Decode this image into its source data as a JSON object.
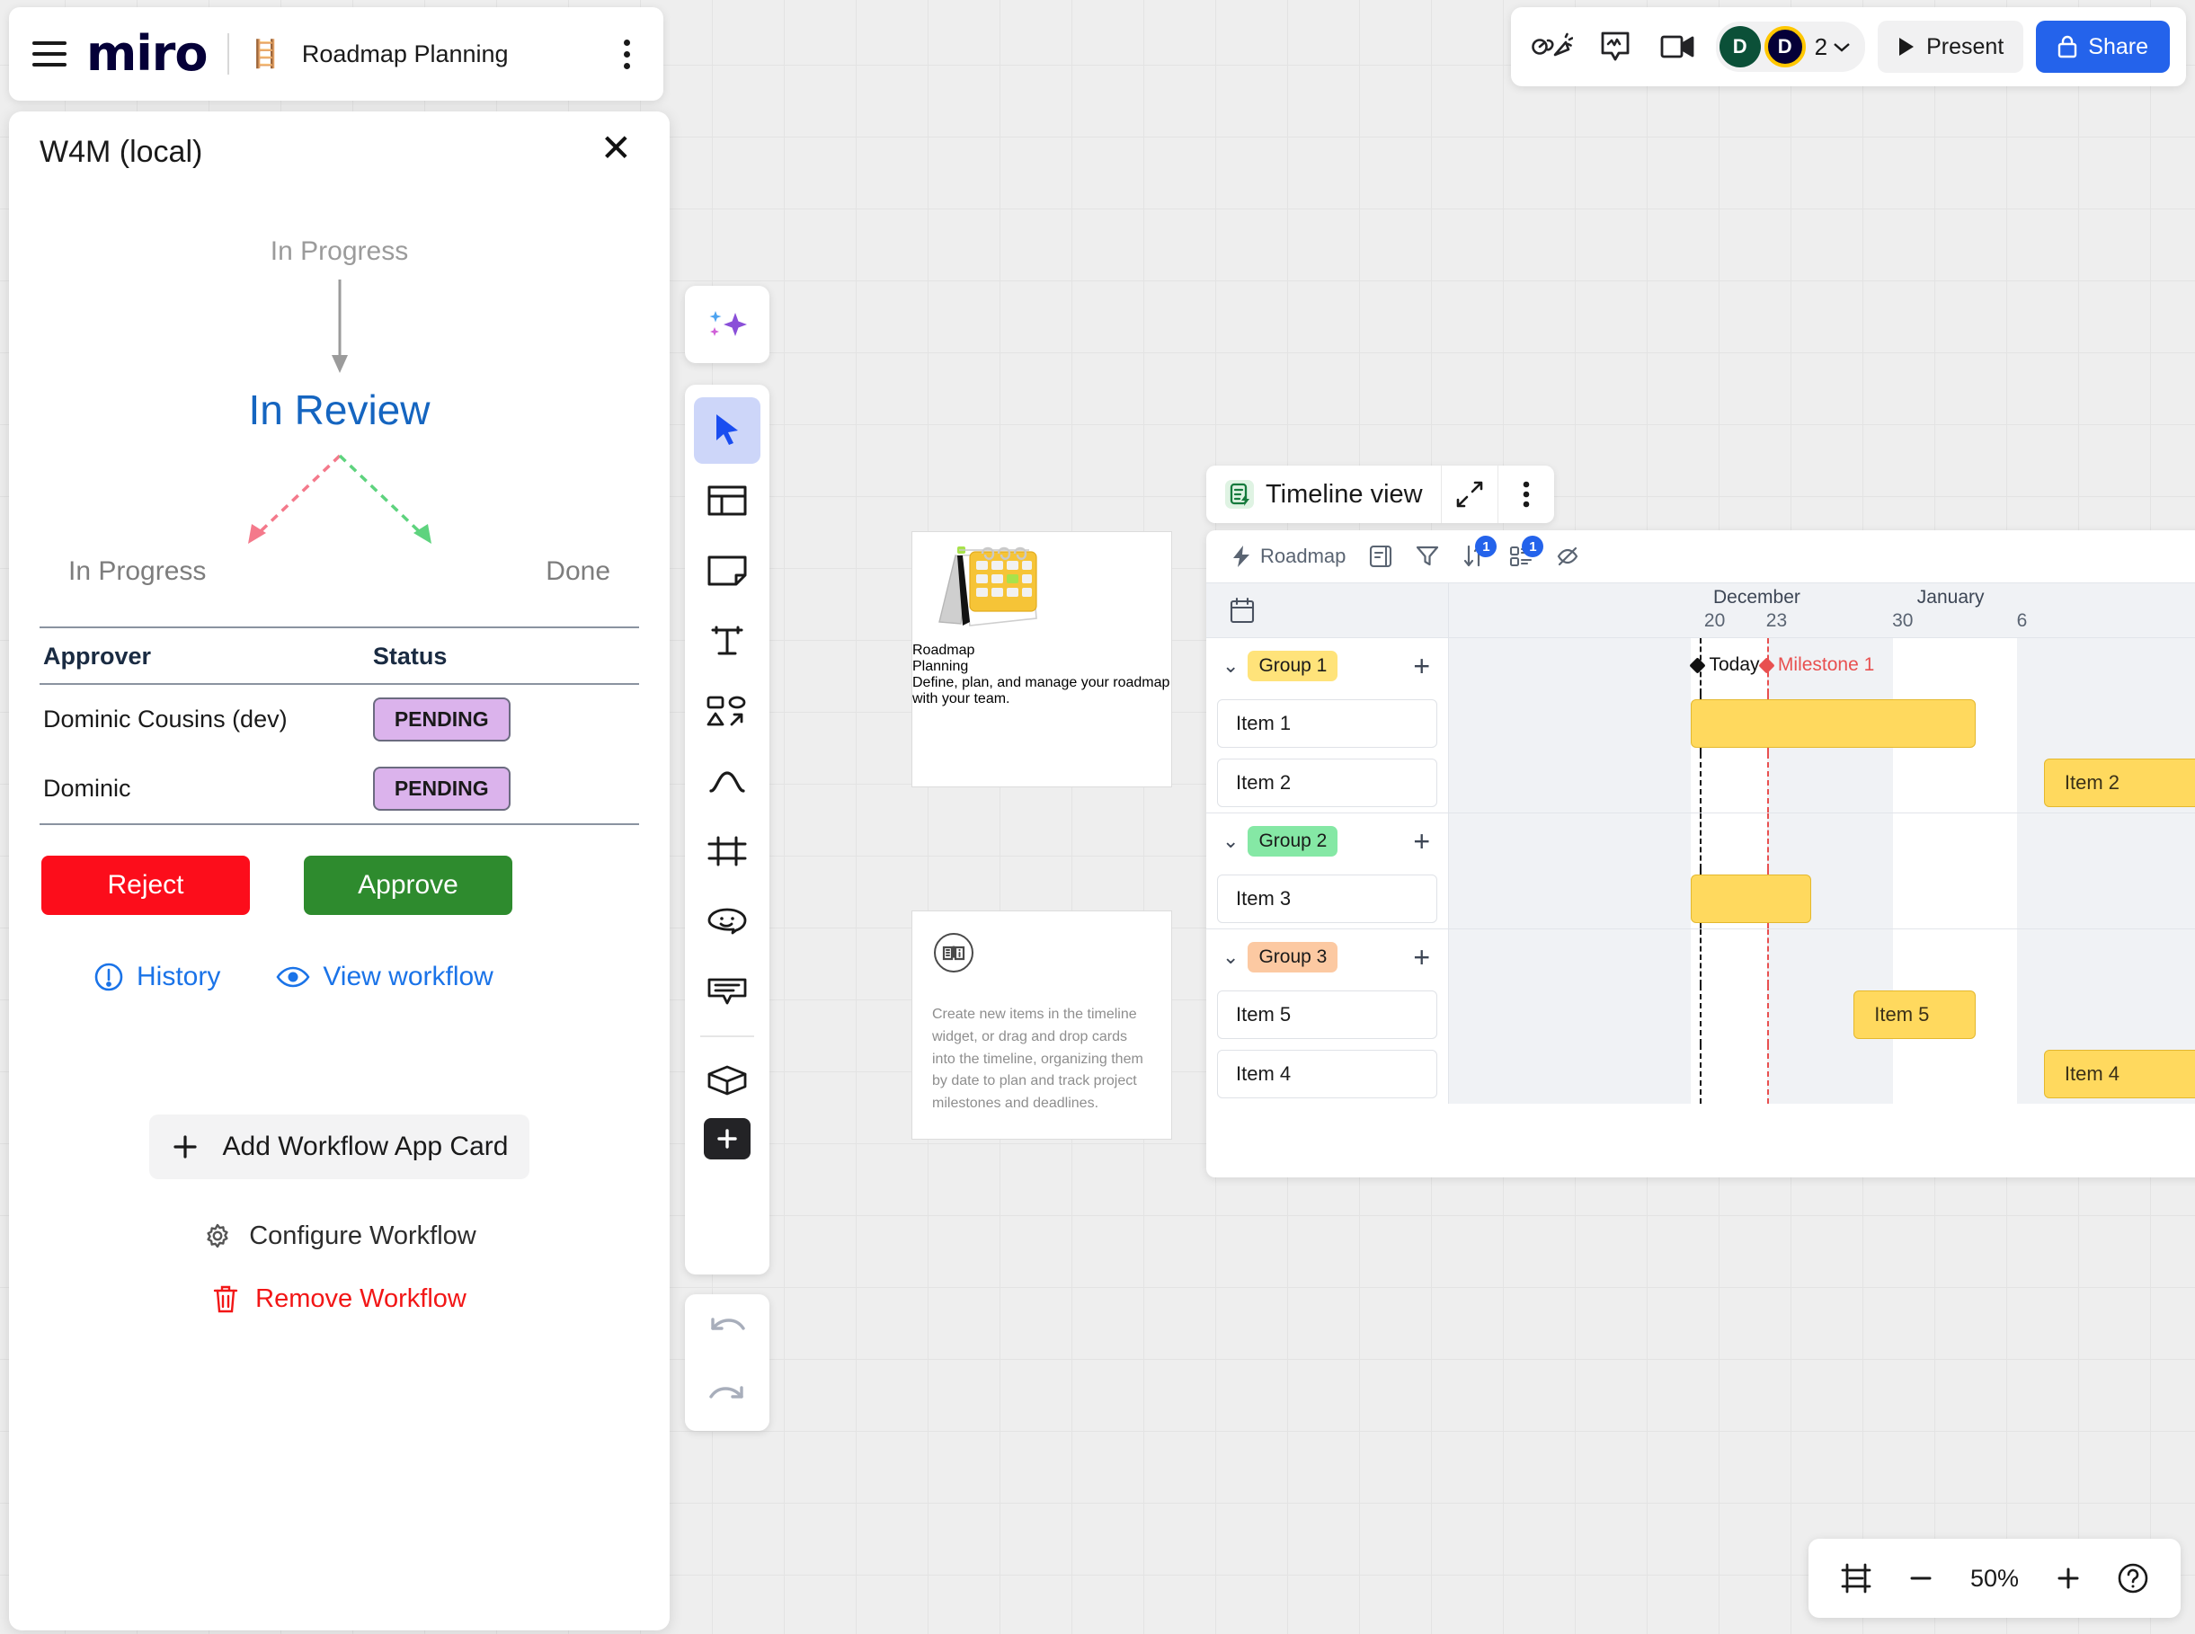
{
  "topbar": {
    "menu_icon": "hamburger-icon",
    "logo": "miro",
    "board_emoji": "🪜",
    "board_title": "Roadmap Planning",
    "more_icon": "kebab-menu-icon"
  },
  "topright": {
    "icons": [
      "reactions-icon",
      "comment-activity-icon",
      "video-chat-icon"
    ],
    "avatars": [
      {
        "initial": "D",
        "color": "#0b5038"
      },
      {
        "initial": "D",
        "color": "#050038",
        "ring": "#ffc700"
      }
    ],
    "collab_count": "2",
    "present_label": "Present",
    "share_label": "Share"
  },
  "w4m": {
    "title": "W4M (local)",
    "close_icon": "close-icon",
    "state_from": "In Progress",
    "state_current": "In Review",
    "target_left": "In Progress",
    "target_right": "Done",
    "table": {
      "headers": [
        "Approver",
        "Status"
      ],
      "rows": [
        {
          "approver": "Dominic Cousins (dev)",
          "status": "PENDING"
        },
        {
          "approver": "Dominic",
          "status": "PENDING"
        }
      ]
    },
    "reject_label": "Reject",
    "approve_label": "Approve",
    "history_label": "History",
    "view_workflow_label": "View workflow",
    "add_card_label": "Add Workflow App Card",
    "configure_label": "Configure Workflow",
    "remove_label": "Remove Workflow",
    "colors": {
      "current_state": "#1565c0",
      "reject": "#fc0d1b",
      "approve": "#2e8b2e",
      "pending_badge": "#dbb3ec",
      "link": "#1a73e8",
      "remove": "#f21616"
    }
  },
  "toolbar": {
    "ai_icon": "ai-sparkle-icon",
    "items": [
      {
        "icon": "cursor-select-icon",
        "active": true
      },
      {
        "icon": "templates-icon",
        "active": false
      },
      {
        "icon": "sticky-note-icon",
        "active": false
      },
      {
        "icon": "text-icon",
        "active": false
      },
      {
        "icon": "shapes-connector-icon",
        "active": false
      },
      {
        "icon": "pen-draw-icon",
        "active": false
      },
      {
        "icon": "frame-icon",
        "active": false
      },
      {
        "icon": "sticker-emoji-icon",
        "active": false
      },
      {
        "icon": "comment-icon",
        "active": false
      },
      {
        "icon": "apps-cube-icon",
        "active": false
      },
      {
        "icon": "more-plus-icon",
        "active": false
      }
    ],
    "undo_icon": "undo-icon",
    "redo_icon": "redo-icon"
  },
  "canvas_cards": {
    "roadmap": {
      "image": "calendar-illustration",
      "title": "Roadmap\nPlanning",
      "title_line1": "Roadmap",
      "title_line2": "Planning",
      "subtitle": "Define, plan, and manage your roadmap with your team."
    },
    "info": {
      "icon": "book-info-icon",
      "text": "Create new items in the timeline widget, or drag and drop cards into the timeline, organizing them by date to plan and track project milestones and deadlines."
    }
  },
  "timeline": {
    "widget_icon": "timeline-app-icon",
    "widget_title": "Timeline view",
    "expand_icon": "expand-diagonal-icon",
    "more_icon": "kebab-menu-icon",
    "toolbar": {
      "roadmap_icon": "lightning-icon",
      "roadmap_label": "Roadmap",
      "tools": [
        {
          "icon": "card-fields-icon",
          "badge": null
        },
        {
          "icon": "filter-icon",
          "badge": null
        },
        {
          "icon": "sort-icon",
          "badge": "1"
        },
        {
          "icon": "group-by-icon",
          "badge": "1"
        },
        {
          "icon": "hide-fields-icon",
          "badge": null
        }
      ]
    },
    "calendar_icon": "calendar-icon",
    "months": [
      {
        "label": "December",
        "left_pct": 35.0
      },
      {
        "label": "January",
        "left_pct": 62.0
      }
    ],
    "day_ticks": [
      {
        "label": "20",
        "left_pct": 33.8
      },
      {
        "label": "23",
        "left_pct": 42.0
      },
      {
        "label": "30",
        "left_pct": 58.7
      },
      {
        "label": "6",
        "left_pct": 75.2
      }
    ],
    "today_marker": {
      "label": "Today",
      "color": "#111111",
      "left_pct": 33.2
    },
    "milestone_marker": {
      "label": "Milestone 1",
      "color": "#e85050",
      "left_pct": 42.2
    },
    "groups": [
      {
        "name": "Group 1",
        "chip_color": "#ffe37a",
        "items": [
          {
            "label": "Item 1",
            "bar_label": "",
            "bar_left_pct": 32.0,
            "bar_width_pct": 37.8
          },
          {
            "label": "Item 2",
            "bar_label": "Item 2",
            "bar_left_pct": 78.8,
            "bar_width_pct": 30.0
          }
        ]
      },
      {
        "name": "Group 2",
        "chip_color": "#85e8a5",
        "items": [
          {
            "label": "Item 3",
            "bar_label": "",
            "bar_left_pct": 32.0,
            "bar_width_pct": 16.0
          }
        ]
      },
      {
        "name": "Group 3",
        "chip_color": "#fcc9a2",
        "items": [
          {
            "label": "Item 5",
            "bar_label": "Item 5",
            "bar_left_pct": 53.6,
            "bar_width_pct": 16.2
          },
          {
            "label": "Item 4",
            "bar_label": "Item 4",
            "bar_left_pct": 78.8,
            "bar_width_pct": 30.0
          }
        ]
      }
    ],
    "bands": [
      {
        "left_pct": 0.0,
        "width_pct": 32.0
      },
      {
        "left_pct": 42.2,
        "width_pct": 16.6
      },
      {
        "left_pct": 75.2,
        "width_pct": 24.8
      }
    ],
    "colors": {
      "bar_fill": "#ffd95e",
      "bar_border": "#e4b82e",
      "band": "#f0f2f5"
    }
  },
  "zoombar": {
    "fit_icon": "fit-to-screen-icon",
    "minus_icon": "minus-icon",
    "level": "50%",
    "plus_icon": "plus-icon",
    "help_icon": "help-icon"
  }
}
